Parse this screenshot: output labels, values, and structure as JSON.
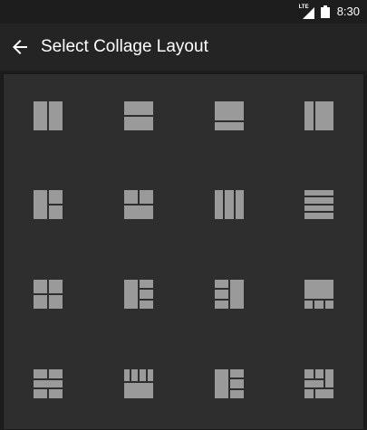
{
  "status_bar": {
    "network_label": "LTE",
    "time": "8:30",
    "icons": [
      "signal-icon",
      "battery-icon"
    ]
  },
  "toolbar": {
    "back_icon": "arrow-back-icon",
    "title": "Select Collage Layout"
  },
  "colors": {
    "status_bar_bg": "#1d1d1d",
    "toolbar_bg": "#242424",
    "grid_bg": "#2e2e2e",
    "layout_icon": "#9a9a9a",
    "text": "#ffffff"
  },
  "layouts": [
    {
      "name": "two-columns"
    },
    {
      "name": "two-rows"
    },
    {
      "name": "large-top-small-bottom"
    },
    {
      "name": "small-left-large-right"
    },
    {
      "name": "left-column-right-split"
    },
    {
      "name": "top-split-bottom-wide"
    },
    {
      "name": "three-columns"
    },
    {
      "name": "four-rows"
    },
    {
      "name": "two-by-two"
    },
    {
      "name": "left-column-right-three"
    },
    {
      "name": "left-three-right-column"
    },
    {
      "name": "top-large-bottom-three"
    },
    {
      "name": "mixed-left-right-column"
    },
    {
      "name": "top-four-bottom-wide"
    },
    {
      "name": "left-column-right-stack"
    },
    {
      "name": "grid-complex"
    }
  ]
}
